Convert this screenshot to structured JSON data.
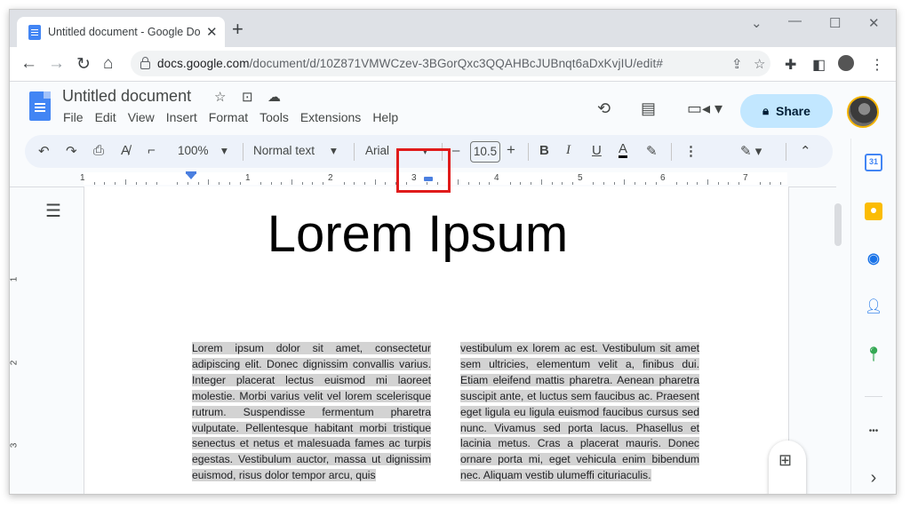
{
  "browser": {
    "tab_title": "Untitled document - Google Docs",
    "tab_close": "✕",
    "new_tab": "+",
    "url_host": "docs.google.com",
    "url_path": "/document/d/10Z871VMWCzev-3BGorQxc3QQAHBcJUBnqt6aDxKvjIU/edit#"
  },
  "docs": {
    "title": "Untitled document",
    "menu": [
      "File",
      "Edit",
      "View",
      "Insert",
      "Format",
      "Tools",
      "Extensions",
      "Help"
    ],
    "share_label": "Share"
  },
  "toolbar": {
    "zoom": "100%",
    "style": "Normal text",
    "font": "Arial",
    "font_size": "10.5",
    "minus": "–",
    "plus": "+"
  },
  "ruler": {
    "numbers": [
      "1",
      "1",
      "2",
      "3",
      "4",
      "5",
      "6",
      "7"
    ],
    "vertical_numbers": [
      "1",
      "2",
      "3"
    ]
  },
  "document": {
    "heading": "Lorem Ipsum",
    "column_left": "Lorem ipsum dolor sit amet, consectetur adipiscing elit. Donec dignissim convallis varius. Integer placerat lectus euismod mi laoreet molestie. Morbi varius velit vel lorem scelerisque rutrum. Suspendisse fermentum pharetra vulputate. Pellentesque habitant morbi tristique senectus et netus et malesuada fames ac turpis egestas. Vestibulum auctor, massa ut dignissim euismod, risus dolor tempor arcu, quis",
    "column_right": "vestibulum ex lorem ac est. Vestibulum sit amet sem ultricies, elementum velit a, finibus dui. Etiam eleifend mattis pharetra. Aenean pharetra suscipit ante, et luctus sem faucibus ac. Praesent eget ligula eu ligula euismod faucibus cursus sed nunc. Vivamus sed porta lacus. Phasellus et lacinia metus. Cras a placerat mauris. Donec ornare porta mi, eget vehicula enim bibendum nec. Aliquam vestib ulumeffi cituriaculis."
  },
  "side_panel": {
    "calendar_label": "31",
    "more_label": "•••",
    "expand_label": "›"
  },
  "colors": {
    "accent": "#4285f4",
    "share_bg": "#c2e7ff",
    "highlight_box": "#e01b1b",
    "text_selection": "#d3d3d3"
  },
  "icons": [
    "docs-logo-icon",
    "star-icon",
    "move-to-folder-icon",
    "cloud-status-icon",
    "history-icon",
    "comment-icon",
    "meet-icon",
    "lock-icon",
    "undo-icon",
    "redo-icon",
    "print-icon",
    "spellcheck-icon",
    "paint-format-icon",
    "bold-icon",
    "italic-icon",
    "underline-icon",
    "text-color-icon",
    "highlight-icon",
    "more-icon",
    "edit-mode-icon",
    "collapse-icon",
    "outline-icon",
    "calendar-icon",
    "keep-icon",
    "tasks-icon",
    "contacts-icon",
    "maps-icon",
    "add-comment-icon"
  ]
}
